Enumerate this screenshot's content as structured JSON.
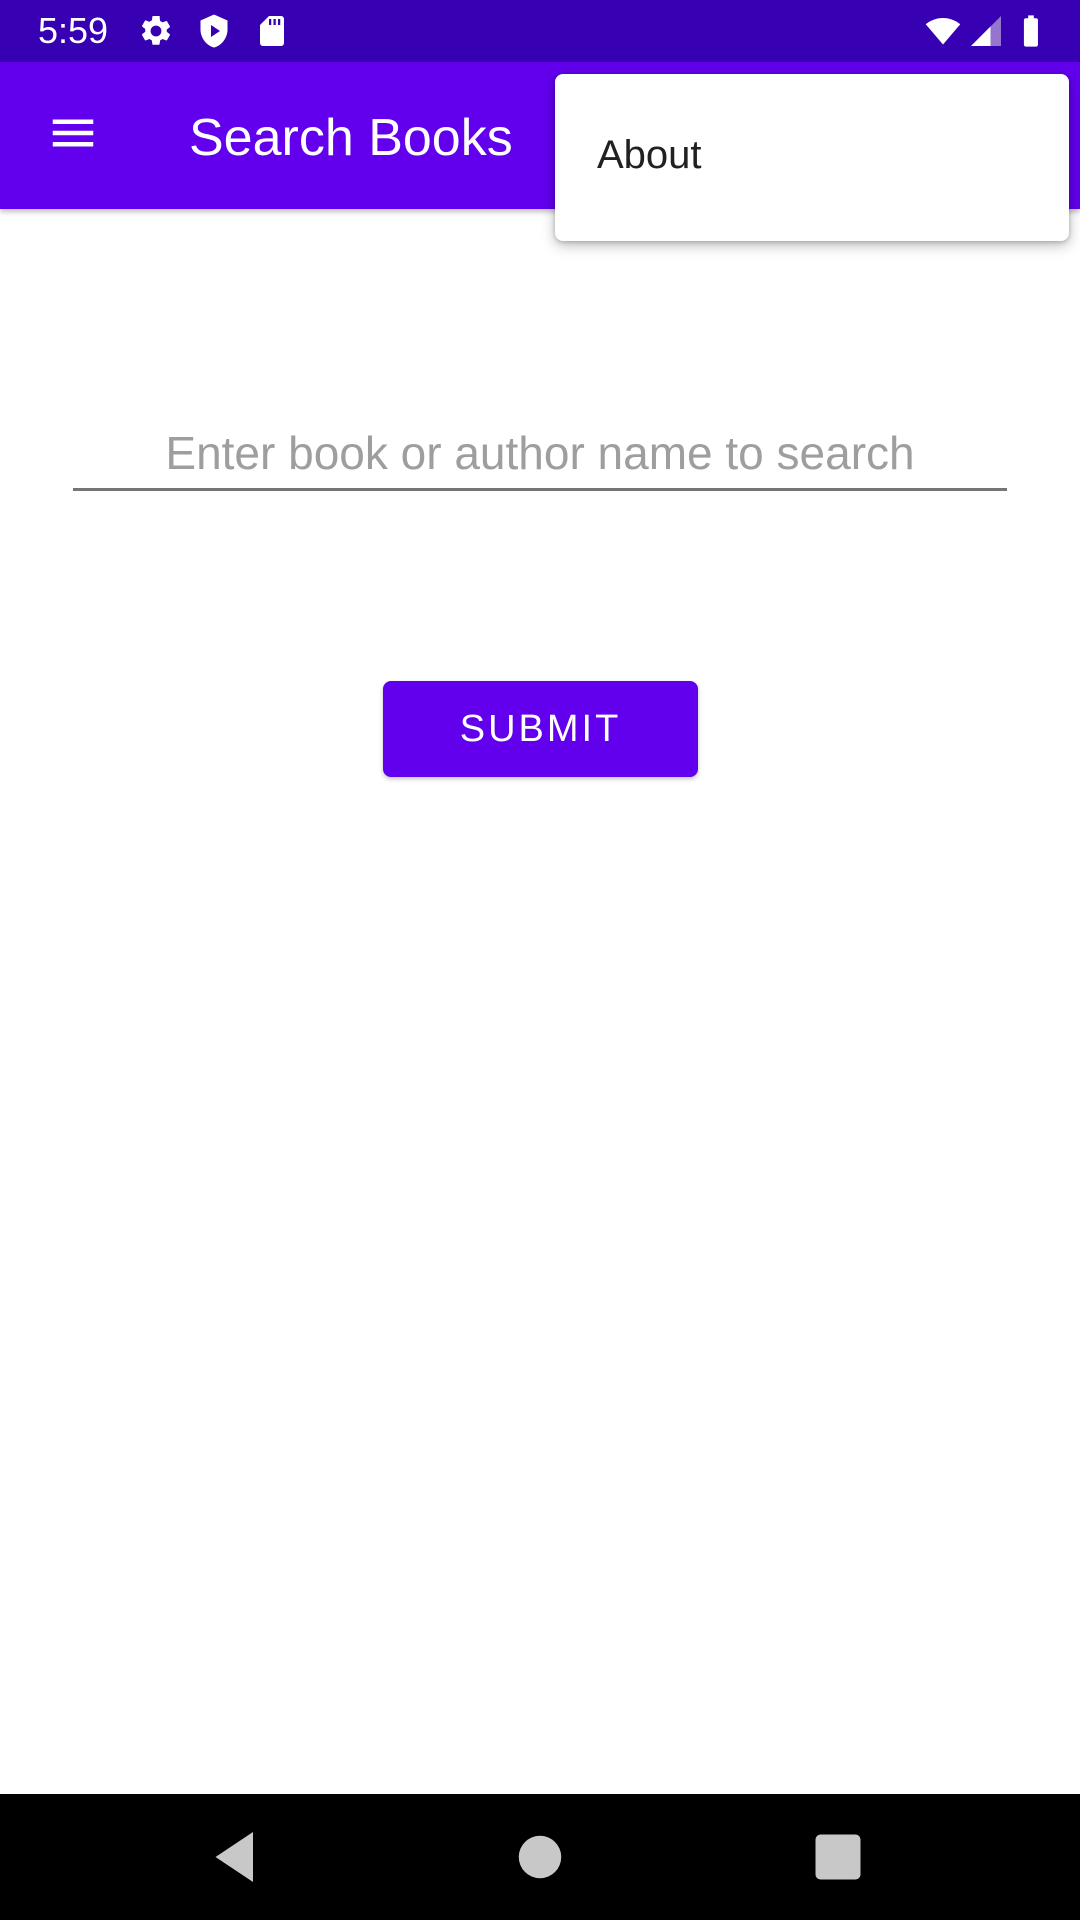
{
  "status_bar": {
    "time": "5:59",
    "icons": [
      "settings-icon",
      "play-protect-icon",
      "sd-card-icon",
      "wifi-icon",
      "cellular-signal-icon",
      "battery-icon"
    ]
  },
  "app_bar": {
    "title": "Search Books",
    "menu_icon": "hamburger-menu-icon"
  },
  "overflow_menu": {
    "items": [
      {
        "label": "About"
      }
    ]
  },
  "search": {
    "placeholder": "Enter book or author name to search",
    "value": ""
  },
  "submit": {
    "label": "SUBMIT"
  },
  "nav_bar": {
    "buttons": [
      "back-icon",
      "home-icon",
      "recents-icon"
    ]
  },
  "colors": {
    "status_bar": "#3700b3",
    "primary": "#6200ee",
    "placeholder": "#9e9e9e"
  }
}
